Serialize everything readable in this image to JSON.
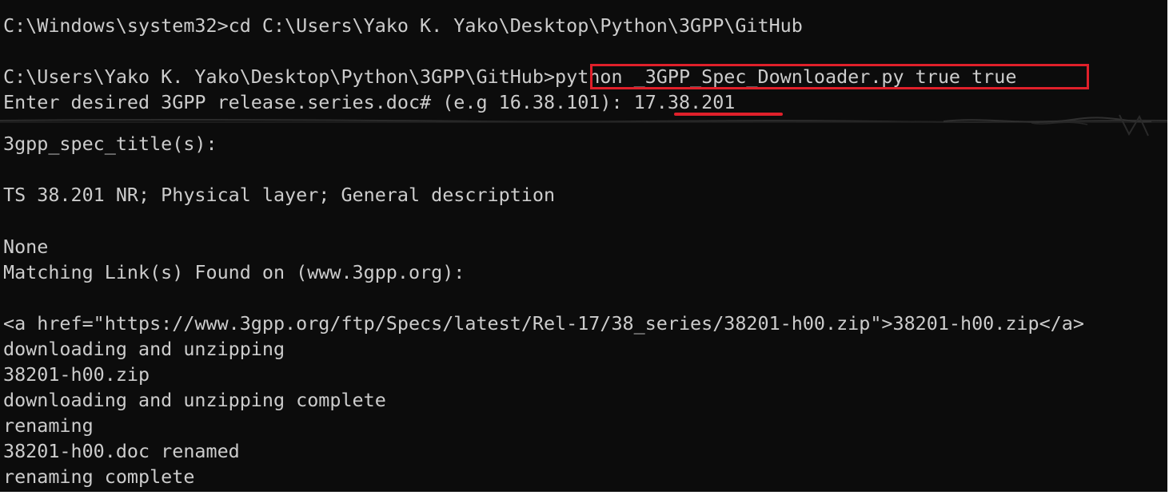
{
  "terminal": {
    "lines": [
      "C:\\Windows\\system32>cd C:\\Users\\Yako K. Yako\\Desktop\\Python\\3GPP\\GitHub",
      "C:\\Users\\Yako K. Yako\\Desktop\\Python\\3GPP\\GitHub>python _3GPP_Spec_Downloader.py true true",
      "Enter desired 3GPP release.series.doc# (e.g 16.38.101): 17.38.201",
      "3gpp_spec_title(s):",
      "TS 38.201 NR; Physical layer; General description",
      "None",
      "Matching Link(s) Found on (www.3gpp.org):",
      "<a href=\"https://www.3gpp.org/ftp/Specs/latest/Rel-17/38_series/38201-h00.zip\">38201-h00.zip</a>",
      "downloading and unzipping",
      "38201-h00.zip",
      "downloading and unzipping complete",
      "renaming",
      "38201-h00.doc renamed",
      "renaming complete"
    ]
  },
  "annotations": {
    "highlight_color": "#e0202a",
    "boxed_text": "python _3GPP_Spec_Downloader.py true true",
    "underlined_text": "17.38.201"
  },
  "colors": {
    "background": "#0c0c0c",
    "text": "#cccccc"
  }
}
